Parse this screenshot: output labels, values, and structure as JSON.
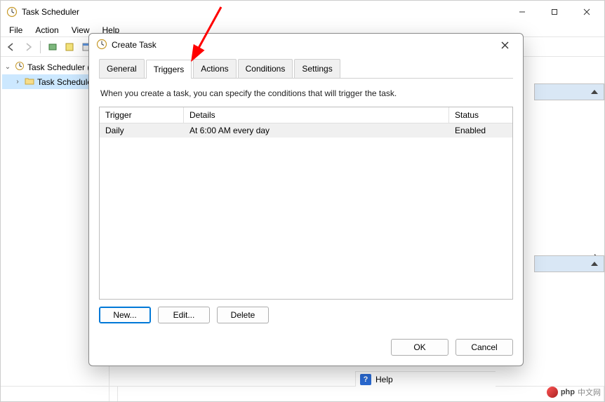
{
  "window": {
    "title": "Task Scheduler"
  },
  "menu": {
    "file": "File",
    "action": "Action",
    "view": "View",
    "help": "Help"
  },
  "tree": {
    "root": "Task Scheduler (L",
    "child": "Task Schedule"
  },
  "dialog": {
    "title": "Create Task",
    "tabs": {
      "general": "General",
      "triggers": "Triggers",
      "actions": "Actions",
      "conditions": "Conditions",
      "settings": "Settings"
    },
    "description": "When you create a task, you can specify the conditions that will trigger the task.",
    "columns": {
      "trigger": "Trigger",
      "details": "Details",
      "status": "Status"
    },
    "rows": [
      {
        "trigger": "Daily",
        "details": "At 6:00 AM every day",
        "status": "Enabled"
      }
    ],
    "buttons": {
      "new": "New...",
      "edit": "Edit...",
      "delete": "Delete",
      "ok": "OK",
      "cancel": "Cancel"
    }
  },
  "help": {
    "label": "Help"
  },
  "watermark": "中文网"
}
